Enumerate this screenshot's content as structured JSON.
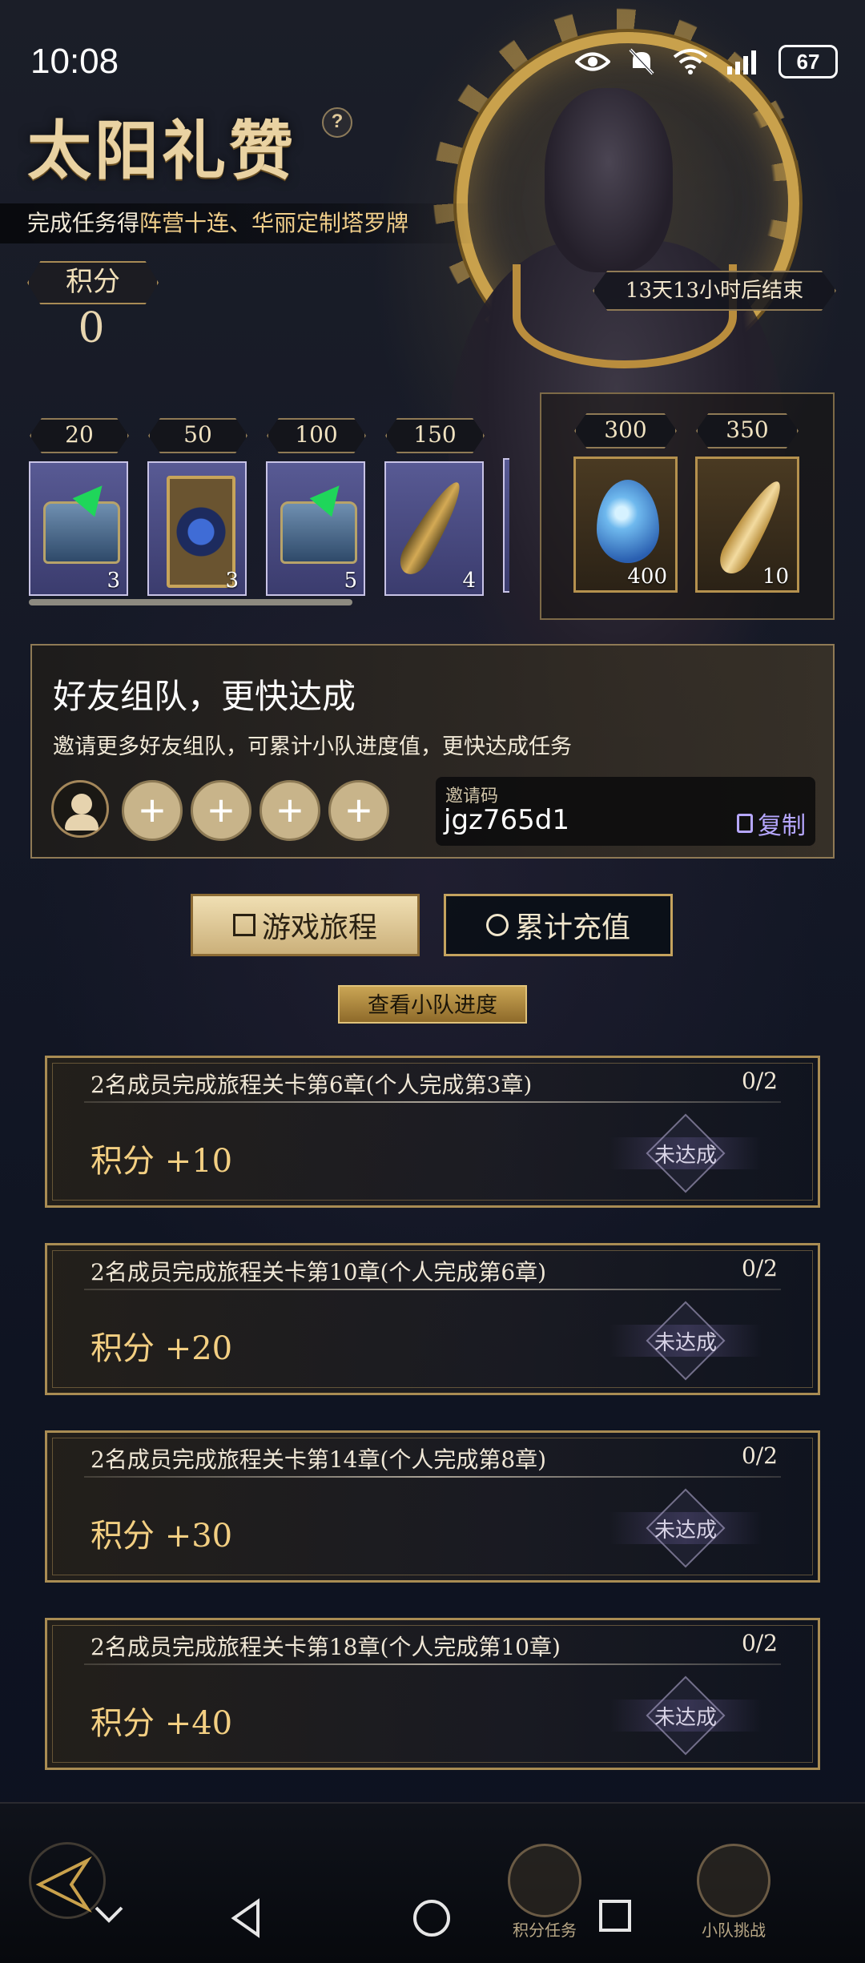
{
  "status_bar": {
    "time": "10:08",
    "battery": "67"
  },
  "event": {
    "title": "太阳礼赞",
    "help": "?",
    "subtitle_prefix": "完成任务得",
    "subtitle_highlight": "阵营十连、华丽定制塔罗牌",
    "score_label": "积分",
    "score_value": "0",
    "countdown": "13天13小时后结束"
  },
  "milestones": [
    {
      "cost": "20",
      "item_icon": "chest-icon",
      "count": "3"
    },
    {
      "cost": "50",
      "item_icon": "tarot-card-icon",
      "count": "3"
    },
    {
      "cost": "100",
      "item_icon": "chest-icon",
      "count": "5"
    },
    {
      "cost": "150",
      "item_icon": "feather-icon",
      "count": "4"
    }
  ],
  "big_rewards": [
    {
      "cost": "300",
      "item_icon": "gem-icon",
      "count": "400"
    },
    {
      "cost": "350",
      "item_icon": "gold-feather-icon",
      "count": "10"
    }
  ],
  "team": {
    "title": "好友组队，更快达成",
    "description": "邀请更多好友组队，可累计小队进度值，更快达成任务",
    "invite_label": "邀请码",
    "invite_code": "jgz765d1",
    "copy_label": "复制",
    "slots": [
      "+",
      "+",
      "+",
      "+"
    ]
  },
  "tabs": {
    "journey": "游戏旅程",
    "recharge": "累计充值",
    "view_progress": "查看小队进度"
  },
  "tasks": [
    {
      "desc": "2名成员完成旅程关卡第6章(个人完成第3章)",
      "progress": "0/2",
      "reward": "积分 +10",
      "status": "未达成"
    },
    {
      "desc": "2名成员完成旅程关卡第10章(个人完成第6章)",
      "progress": "0/2",
      "reward": "积分 +20",
      "status": "未达成"
    },
    {
      "desc": "2名成员完成旅程关卡第14章(个人完成第8章)",
      "progress": "0/2",
      "reward": "积分 +30",
      "status": "未达成"
    },
    {
      "desc": "2名成员完成旅程关卡第18章(个人完成第10章)",
      "progress": "0/2",
      "reward": "积分 +40",
      "status": "未达成"
    }
  ],
  "bottom_tabs": {
    "points_task": "积分任务",
    "team_challenge": "小队挑战"
  },
  "colors": {
    "gold": "#c9a14c",
    "accent_text": "#f3cf82",
    "copy": "#b6a7ff"
  }
}
